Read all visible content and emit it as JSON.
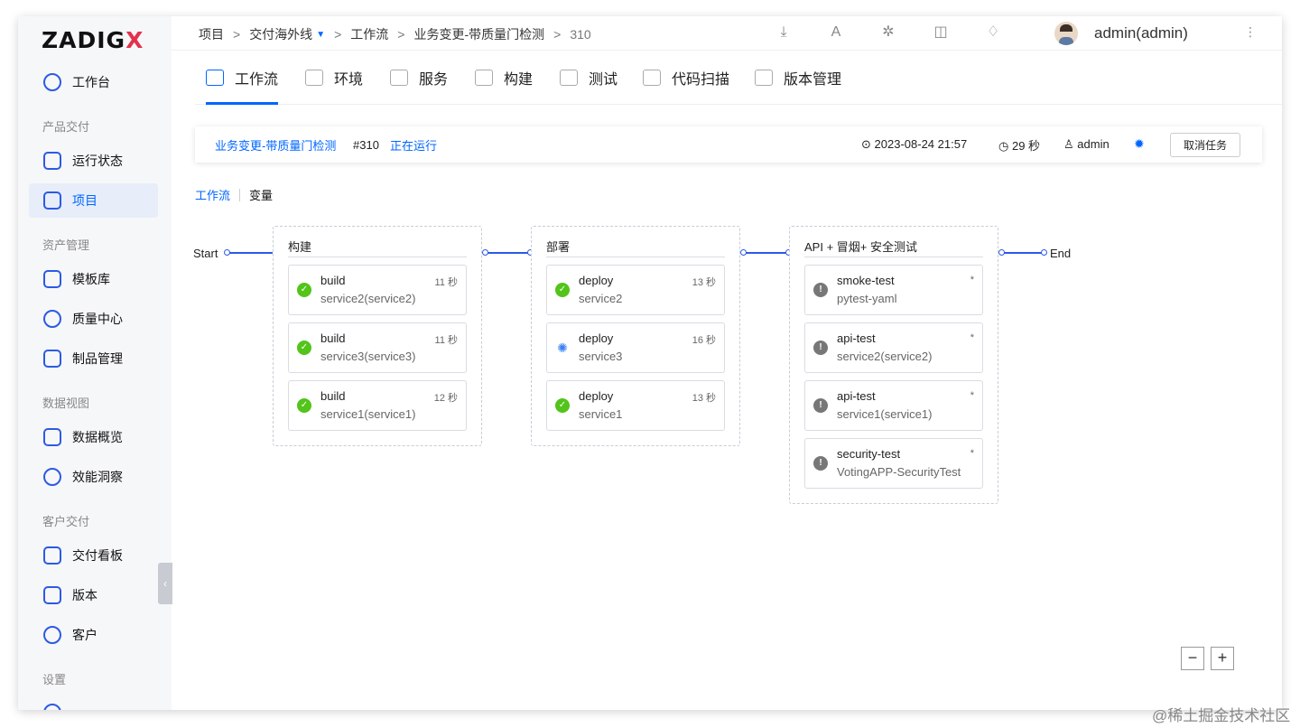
{
  "app": {
    "logo_main": "ZADIG",
    "logo_x": "X"
  },
  "sidebar": {
    "dashboard": "工作台",
    "sections": {
      "product": "产品交付",
      "assets": "资产管理",
      "data": "数据视图",
      "customer": "客户交付",
      "settings": "设置"
    },
    "items": [
      {
        "label": "运行状态",
        "icon": "activity-icon"
      },
      {
        "label": "项目",
        "icon": "project-icon"
      },
      {
        "label": "模板库",
        "icon": "template-icon"
      },
      {
        "label": "质量中心",
        "icon": "flask-icon"
      },
      {
        "label": "制品管理",
        "icon": "package-icon"
      },
      {
        "label": "数据概览",
        "icon": "monitor-icon"
      },
      {
        "label": "效能洞察",
        "icon": "pie-chart-icon"
      },
      {
        "label": "交付看板",
        "icon": "clipboard-icon"
      },
      {
        "label": "版本",
        "icon": "version-icon"
      },
      {
        "label": "客户",
        "icon": "users-icon"
      }
    ]
  },
  "breadcrumb": {
    "items": [
      "项目",
      "交付海外线",
      "工作流",
      "业务变更-带质量门检测",
      "310"
    ],
    "sep": ">"
  },
  "user": {
    "name": "admin(admin)"
  },
  "tabs": [
    "工作流",
    "环境",
    "服务",
    "构建",
    "测试",
    "代码扫描",
    "版本管理"
  ],
  "task": {
    "name": "业务变更-带质量门检测",
    "number": "#310",
    "status": "正在运行",
    "time": "2023-08-24 21:57",
    "duration": "29 秒",
    "creator": "admin",
    "cancel_label": "取消任务"
  },
  "subtabs": [
    "工作流",
    "变量"
  ],
  "pipeline": {
    "start": "Start",
    "end": "End",
    "stages": [
      {
        "title": "构建",
        "jobs": [
          {
            "name": "build",
            "service": "service2(service2)",
            "time": "11 秒",
            "status": "success"
          },
          {
            "name": "build",
            "service": "service3(service3)",
            "time": "11 秒",
            "status": "success"
          },
          {
            "name": "build",
            "service": "service1(service1)",
            "time": "12 秒",
            "status": "success"
          }
        ]
      },
      {
        "title": "部署",
        "jobs": [
          {
            "name": "deploy",
            "service": "service2",
            "time": "13 秒",
            "status": "success"
          },
          {
            "name": "deploy",
            "service": "service3",
            "time": "16 秒",
            "status": "running"
          },
          {
            "name": "deploy",
            "service": "service1",
            "time": "13 秒",
            "status": "success"
          }
        ]
      },
      {
        "title": "API + 冒烟+ 安全测试",
        "jobs": [
          {
            "name": "smoke-test",
            "service": "pytest-yaml",
            "time": "*",
            "status": "waiting"
          },
          {
            "name": "api-test",
            "service": "service2(service2)",
            "time": "*",
            "status": "waiting"
          },
          {
            "name": "api-test",
            "service": "service1(service1)",
            "time": "*",
            "status": "waiting"
          },
          {
            "name": "security-test",
            "service": "VotingAPP-SecurityTest",
            "time": "*",
            "status": "waiting"
          }
        ]
      }
    ]
  },
  "zoom": {
    "out": "−",
    "in": "+"
  },
  "watermark": "@稀土掘金技术社区",
  "colors": {
    "accent": "#0066ff",
    "success": "#52c41a",
    "waiting": "#777777"
  }
}
